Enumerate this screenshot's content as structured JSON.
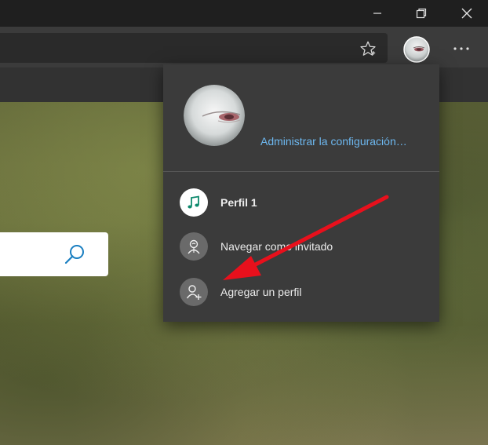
{
  "window": {
    "minimize_icon": "minimize-icon",
    "maximize_icon": "restore-icon",
    "close_icon": "close-icon"
  },
  "toolbar": {
    "favorite_icon": "star-icon",
    "profile_icon": "profile-avatar",
    "more_icon": "more-horizontal-icon"
  },
  "page": {
    "search_icon": "search-icon"
  },
  "profile_flyout": {
    "manage_link": "Administrar la configuración…",
    "items": [
      {
        "label": "Perfil 1",
        "icon": "music-note-icon",
        "active": true
      },
      {
        "label": "Navegar como invitado",
        "icon": "guest-icon",
        "active": false
      },
      {
        "label": "Agregar un perfil",
        "icon": "add-person-icon",
        "active": false
      }
    ]
  },
  "annotation": {
    "color": "#e8101c"
  },
  "colors": {
    "link": "#6db8f0",
    "flyout_bg": "#3b3b3b",
    "titlebar_bg": "#1f1f1f"
  }
}
